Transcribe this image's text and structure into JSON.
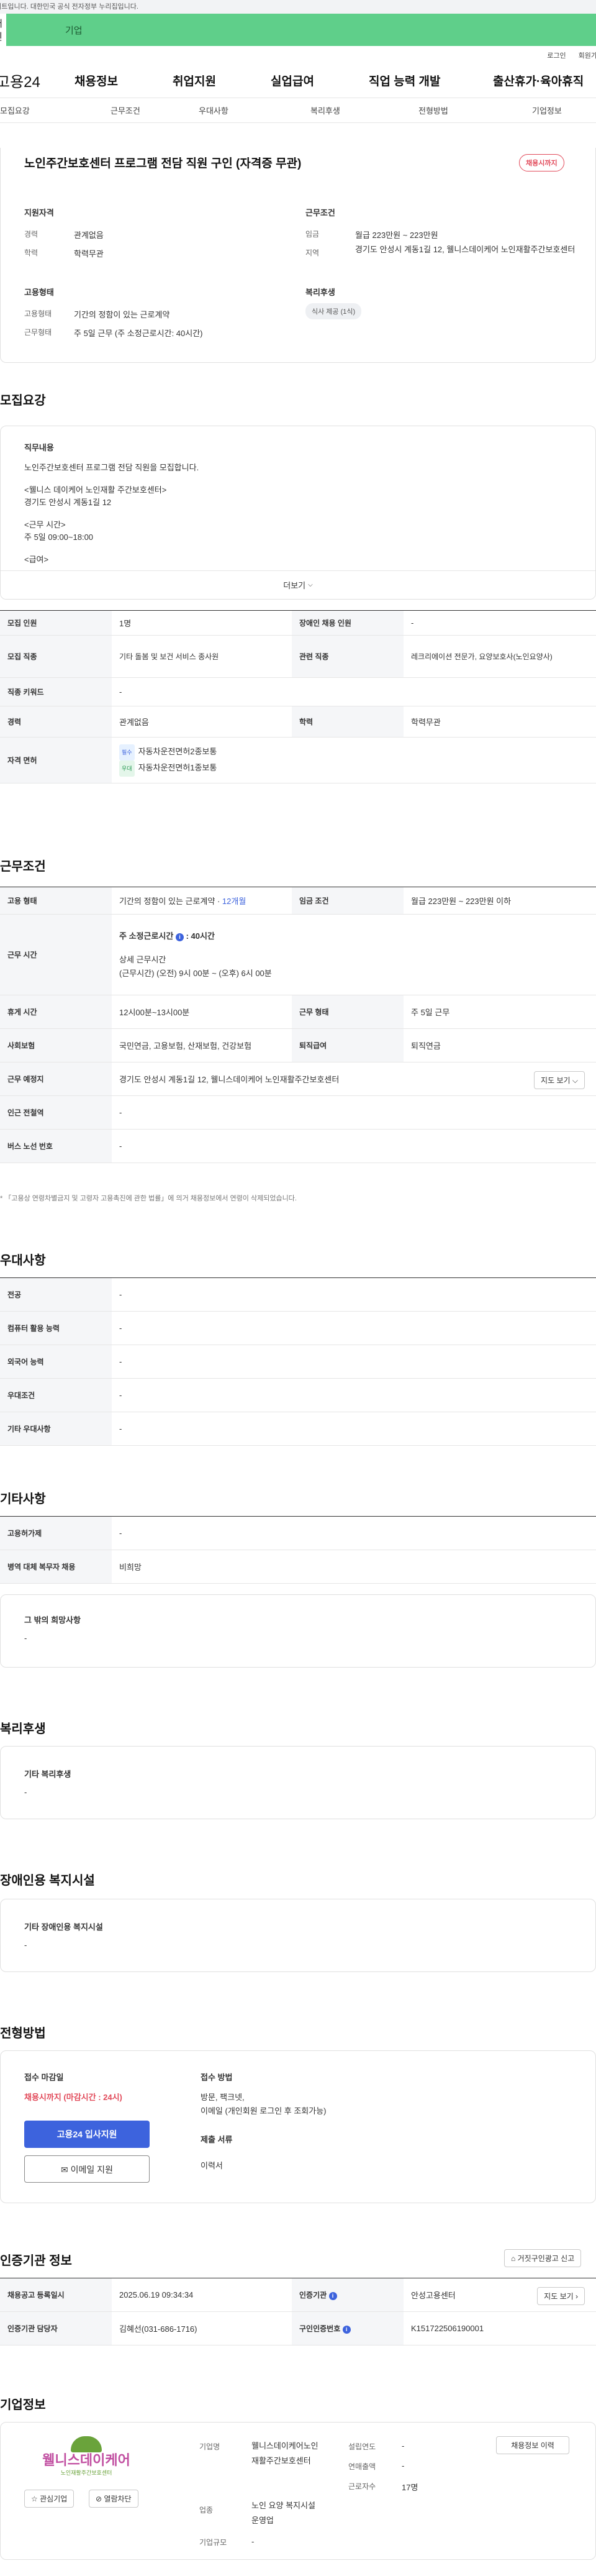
{
  "topbar": {
    "notice": "사이트입니다. 대한민국 공식 전자정부 누리집입니다."
  },
  "user_tabs": {
    "personal": "개인",
    "business": "기업"
  },
  "util": {
    "login": "로그인",
    "join": "회원가"
  },
  "gnb": {
    "logo": "고용24",
    "items": [
      "채용정보",
      "취업지원",
      "실업급여",
      "직업 능력 개발",
      "출산휴가·육아휴직"
    ]
  },
  "subnav": {
    "items": [
      "모집요강",
      "근무조건",
      "우대사항",
      "복리후생",
      "전형방법",
      "기업정보"
    ]
  },
  "header": {
    "title": "노인주간보호센터 프로그램 전담 직원 구인 (자격증 무관)",
    "status_badge": "채용시까지"
  },
  "summary": {
    "qual_title": "지원자격",
    "cond_title": "근무조건",
    "emp_title": "고용형태",
    "welfare_title": "복리후생",
    "career_k": "경력",
    "career_v": "관계없음",
    "edu_k": "학력",
    "edu_v": "학력무관",
    "wage_k": "임금",
    "wage_v": "월급 223만원 ~ 223만원",
    "loc_k": "지역",
    "loc_v": "경기도 안성시 계동1길 12, 웰니스데이케어 노인재활주간보호센터",
    "type_k": "고용형태",
    "type_v": "기간의 정함이 있는 근로계약",
    "hours_k": "근무형태",
    "hours_v": "주 5일 근무 (주 소정근로시간: 40시간)",
    "welfare_pill": "식사 제공 (1식)"
  },
  "recruit": {
    "title": "모집요강",
    "duty_title": "직무내용",
    "duty_lines": [
      "노인주간보호센터 프로그램 전담 직원을 모집합니다.",
      "<웰니스 데이케어 노인재활 주간보호센터>",
      "경기도 안성시 계동1길 12",
      "<근무 시간>",
      "주 5일 09:00~18:00",
      "<급여>"
    ],
    "more": "더보기"
  },
  "recruit_table": {
    "r1": [
      "모집 인원",
      "1명",
      "장애인 채용 인원",
      "-"
    ],
    "r2": [
      "모집 직종",
      "기타 돌봄 및 보건 서비스 종사원",
      "관련 직종",
      "레크리에이션 전문가, 요양보호사(노인요양사)"
    ],
    "r3": [
      "직종 키워드",
      "-"
    ],
    "r4": [
      "경력",
      "관계없음",
      "학력",
      "학력무관"
    ],
    "r5_k": "자격 면허",
    "lic": [
      {
        "tag": "필수",
        "name": "자동차운전면허2종보통"
      },
      {
        "tag": "우대",
        "name": "자동차운전면허1종보통"
      }
    ]
  },
  "work": {
    "title": "근무조건",
    "type_k": "고용 형태",
    "type_v": "기간의 정함이 있는 근로계약",
    "type_months": "12개월",
    "wage_k": "임금 조건",
    "wage_v": "월급 223만원 ~ 223만원 이하",
    "time_k": "근무 시간",
    "time_week": "주 소정근로시간",
    "time_week_v": "40시간",
    "time_detail_t": "상세 근무시간",
    "time_detail_v": "(근무시간) (오전) 9시 00분 ~ (오후) 6시 00분",
    "rest_k": "휴게 시간",
    "rest_v": "12시00분~13시00분",
    "form_k": "근무 형태",
    "form_v": "주 5일 근무",
    "ins_k": "사회보험",
    "ins_v": "국민연금, 고용보험, 산재보험, 건강보험",
    "ret_k": "퇴직급여",
    "ret_v": "퇴직연금",
    "place_k": "근무 예정지",
    "place_v": "경기도 안성시 계동1길 12, 웰니스데이케어 노인재활주간보호센터",
    "map_btn": "지도 보기",
    "sub_k": "인근 전철역",
    "sub_v": "-",
    "bus_k": "버스 노선 번호",
    "bus_v": "-",
    "note": "* 「고용상 연령차별금지 및 고령자 고용촉진에 관한 법률」에 의거 채용정보에서 연령이 삭제되었습니다."
  },
  "pref": {
    "title": "우대사항",
    "rows": [
      [
        "전공",
        "-"
      ],
      [
        "컴퓨터 활용 능력",
        "-"
      ],
      [
        "외국어 능력",
        "-"
      ],
      [
        "우대조건",
        "-"
      ],
      [
        "기타 우대사항",
        "-"
      ]
    ]
  },
  "etc": {
    "title": "기타사항",
    "rows": [
      [
        "고용허가제",
        "-"
      ],
      [
        "병역 대체 복무자 채용",
        "비희망"
      ]
    ],
    "hope_title": "그 밖의 희망사항",
    "hope_v": "-"
  },
  "welfare": {
    "title": "복리후생",
    "box_title": "기타 복리후생",
    "box_v": "-"
  },
  "disab": {
    "title": "장애인용 복지시설",
    "box_title": "기타 장애인용 복지시설",
    "box_v": "-"
  },
  "select": {
    "title": "전형방법",
    "deadline_t": "접수 마감일",
    "deadline_v": "채용시까지 (마감시간 : 24시)",
    "apply_btn": "고용24 입사지원",
    "email_btn": "이메일 지원",
    "method_t": "접수 방법",
    "method_v1": "방문, 팩크넷,",
    "method_v2": "이메일 (개인회원 로그인 후 조회가능)",
    "docs_t": "제출 서류",
    "docs_v": "이력서"
  },
  "agency": {
    "title": "인증기관 정보",
    "report_btn": "거짓구인광고 신고",
    "reg_k": "채용공고 등록일시",
    "reg_v": "2025.06.19 09:34:34",
    "org_k": "인증기관",
    "org_v": "안성고용센터",
    "map_btn": "지도 보기",
    "mgr_k": "인증기관 담당자",
    "mgr_v": "김혜선(031-686-1716)",
    "no_k": "구인인증번호",
    "no_v": "K151722506190001"
  },
  "company": {
    "title": "기업정보",
    "logo_text": "웰니스데이케어",
    "logo_sub": "노인재활주간보호센터",
    "fav_btn": "관심기업",
    "block_btn": "열람차단",
    "jobs_btn": "채용정보 이력",
    "name_k": "기업명",
    "name_v": "웰니스데이케어노인재활주간보호센터",
    "ind_k": "업종",
    "ind_v": "노인 요양 복지시설 운영업",
    "size_k": "기업규모",
    "size_v": "-",
    "est_k": "설립연도",
    "est_v": "-",
    "rev_k": "연매출액",
    "rev_v": "-",
    "emp_k": "근로자수",
    "emp_v": "17명"
  },
  "colors": {
    "accent_green": "#5fcf8a",
    "accent_red": "#e24b5b",
    "accent_blue": "#3d63dd"
  }
}
